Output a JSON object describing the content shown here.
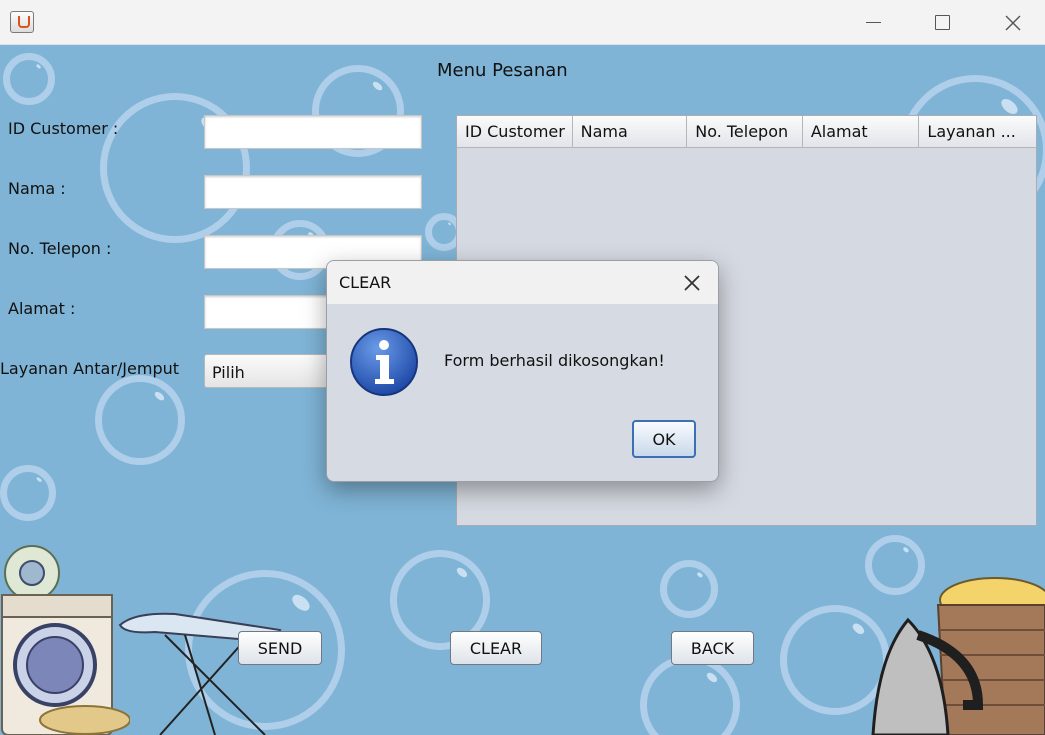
{
  "window": {
    "title": ""
  },
  "form": {
    "title": "Menu Pesanan",
    "labels": {
      "id_customer": "ID Customer :",
      "nama": "Nama :",
      "telepon": "No. Telepon :",
      "alamat": "Alamat :",
      "layanan": "Layanan Antar/Jemput"
    },
    "values": {
      "id_customer": "",
      "nama": "",
      "telepon": "",
      "alamat": ""
    },
    "layanan_selected": "Pilih"
  },
  "table": {
    "columns": [
      "ID Customer",
      "Nama",
      "No. Telepon",
      "Alamat",
      "Layanan ..."
    ],
    "rows": []
  },
  "buttons": {
    "send": "SEND",
    "clear": "CLEAR",
    "back": "BACK"
  },
  "dialog": {
    "title": "CLEAR",
    "message": "Form berhasil dikosongkan!",
    "ok": "OK",
    "icon": "info-icon"
  },
  "colors": {
    "background": "#7fb4d6",
    "bubble": "#bed7f0",
    "dialog_bg": "#d6dae2"
  }
}
